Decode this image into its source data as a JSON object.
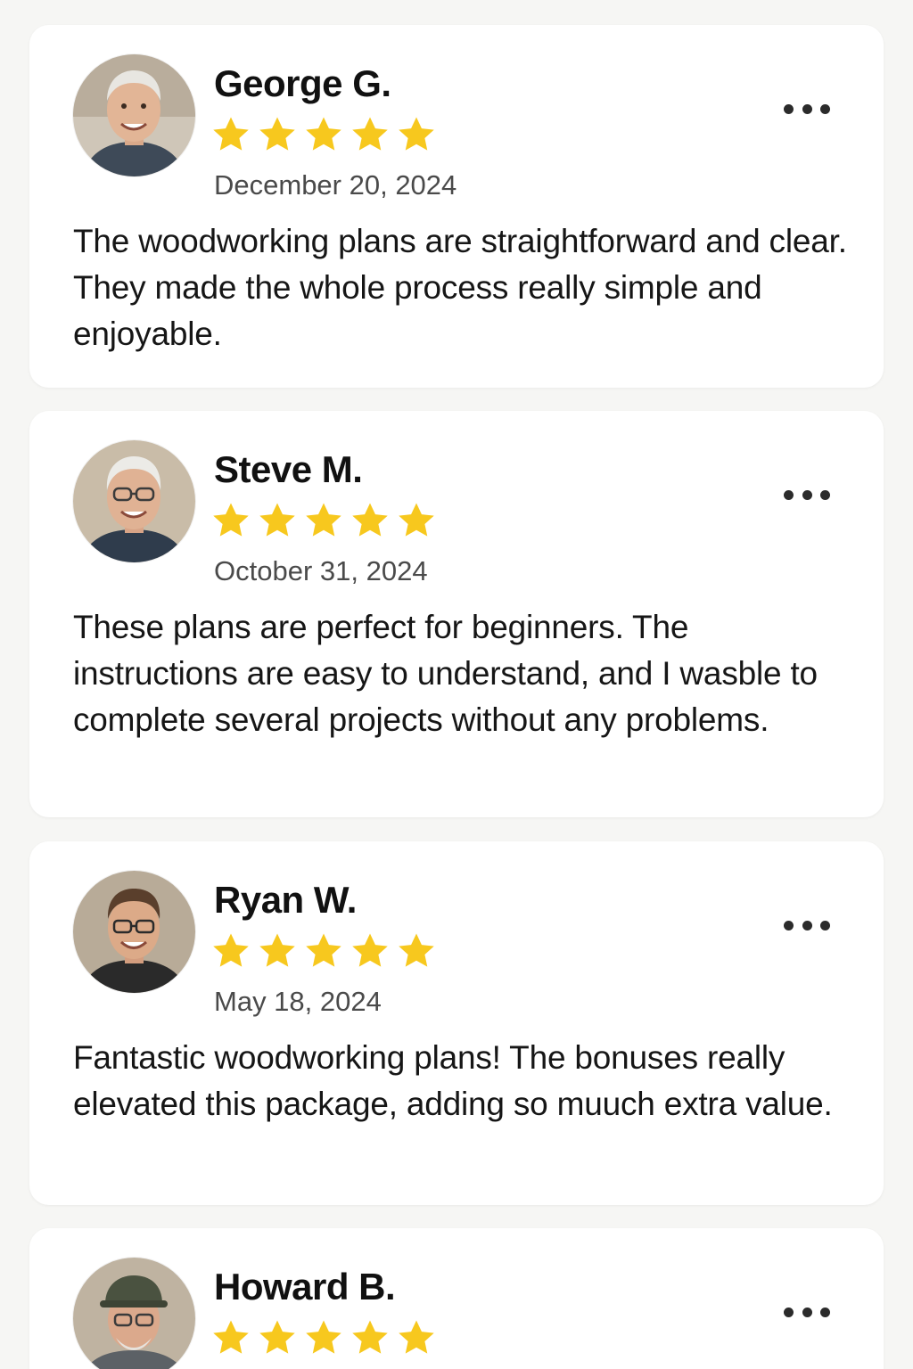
{
  "reviews": [
    {
      "name": "George G.",
      "rating": 5,
      "date": "December 20, 2024",
      "text": "The woodworking plans are straightforward and clear. They made the whole process really simple and enjoyable."
    },
    {
      "name": "Steve M.",
      "rating": 5,
      "date": "October 31, 2024",
      "text": "These plans are perfect for beginners. The instructions are easy to understand, and I wasble to complete several projects without any problems."
    },
    {
      "name": "Ryan W.",
      "rating": 5,
      "date": "May 18, 2024",
      "text": "Fantastic woodworking plans! The bonuses really elevated this package, adding so muuch extra value."
    },
    {
      "name": "Howard B.",
      "rating": 5,
      "date": "",
      "text": ""
    }
  ],
  "icons": {
    "star": "star-icon",
    "more": "more-options-icon"
  },
  "colors": {
    "star": "#F7C81E",
    "background": "#F6F6F4",
    "card": "#FFFFFF",
    "date_text": "#4A4A4A"
  }
}
